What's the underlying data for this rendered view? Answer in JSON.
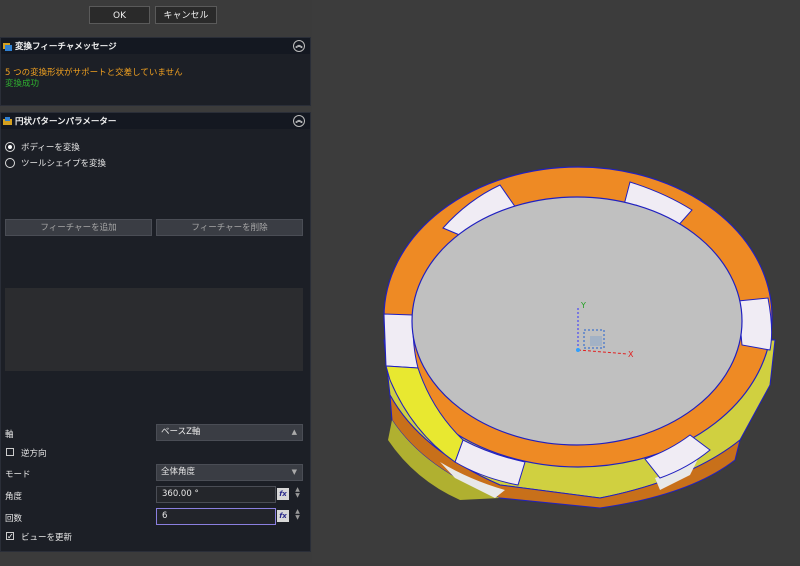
{
  "toolbar": {
    "ok_label": "OK",
    "cancel_label": "キャンセル"
  },
  "message_panel": {
    "title": "変換フィーチャメッセージ",
    "warning": "5 つの変換形状がサポートと交差していません",
    "success": "変換成功",
    "warning_color": "#f0a020",
    "success_color": "#30b030"
  },
  "pattern_panel": {
    "title": "円状パターンパラメーター",
    "radio_body": "ボディーを変換",
    "radio_tool": "ツールシェイプを変換",
    "selected_radio": "ボディーを変換",
    "add_feature": "フィーチャーを追加",
    "remove_feature": "フィーチャーを削除",
    "axis_label": "軸",
    "axis_value": "ベースZ軸",
    "reverse_label": "逆方向",
    "reverse_checked": false,
    "mode_label": "モード",
    "mode_value": "全体角度",
    "angle_label": "角度",
    "angle_value": "360.00 °",
    "count_label": "回数",
    "count_value": "6",
    "update_view_label": "ビューを更新",
    "update_view_checked": true,
    "fx_label": "fx"
  },
  "viewport": {
    "axis_x_label": "X",
    "axis_y_label": "Y",
    "colors": {
      "ring_orange": "#ee8a24",
      "ring_white": "#f0ecf4",
      "ring_yellow": "#e8e830",
      "face_gray": "#c0c0c0",
      "outline_blue": "#2020c0",
      "background": "#3c3c3c"
    },
    "icons": [
      "collapse-icon",
      "radio-icon",
      "checkbox-icon",
      "fx-icon",
      "axis-triad-icon"
    ]
  }
}
